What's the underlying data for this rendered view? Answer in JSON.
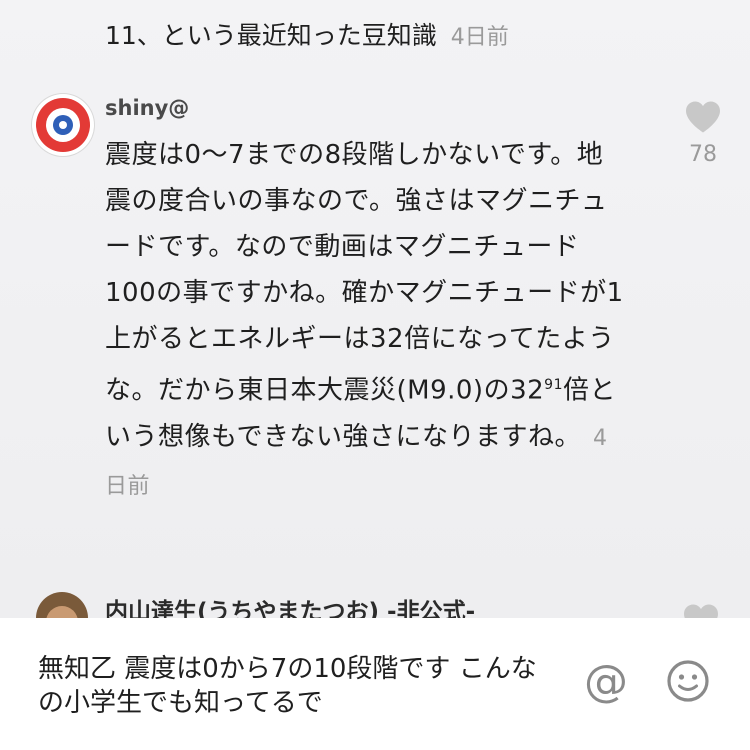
{
  "thread": {
    "snippet_text": "11、という最近知った豆知識",
    "snippet_time": "4日前"
  },
  "comment": {
    "username": "shiny@",
    "body": "震度は0〜7までの8段階しかないです。地震の度合いの事なので。強さはマグニチュードです。なので動画はマグニチュード100の事ですかね。確かマグニチュードが1上がるとエネルギーは32倍になってたような。だから東日本大震災(M9.0)の32",
    "superscript": "91",
    "body_end": "倍という想像もできない強さになりますね。",
    "time": "4日前",
    "likes": "78",
    "avatar_icon": "blue-eye-logo-icon"
  },
  "next_comment": {
    "username": "内山達生(うちやまたつお) -非公式-"
  },
  "composer": {
    "text": "無知乙 震度は0から7の10段階です こんなの小学生でも知ってるで",
    "mention_symbol": "@",
    "emoji_icon": "smiley-icon"
  },
  "colors": {
    "like_heart": "#c8c8c8",
    "meta_text": "#9a9a9a",
    "avatar_red": "#e33a36",
    "avatar_blue": "#2f5fb8"
  }
}
